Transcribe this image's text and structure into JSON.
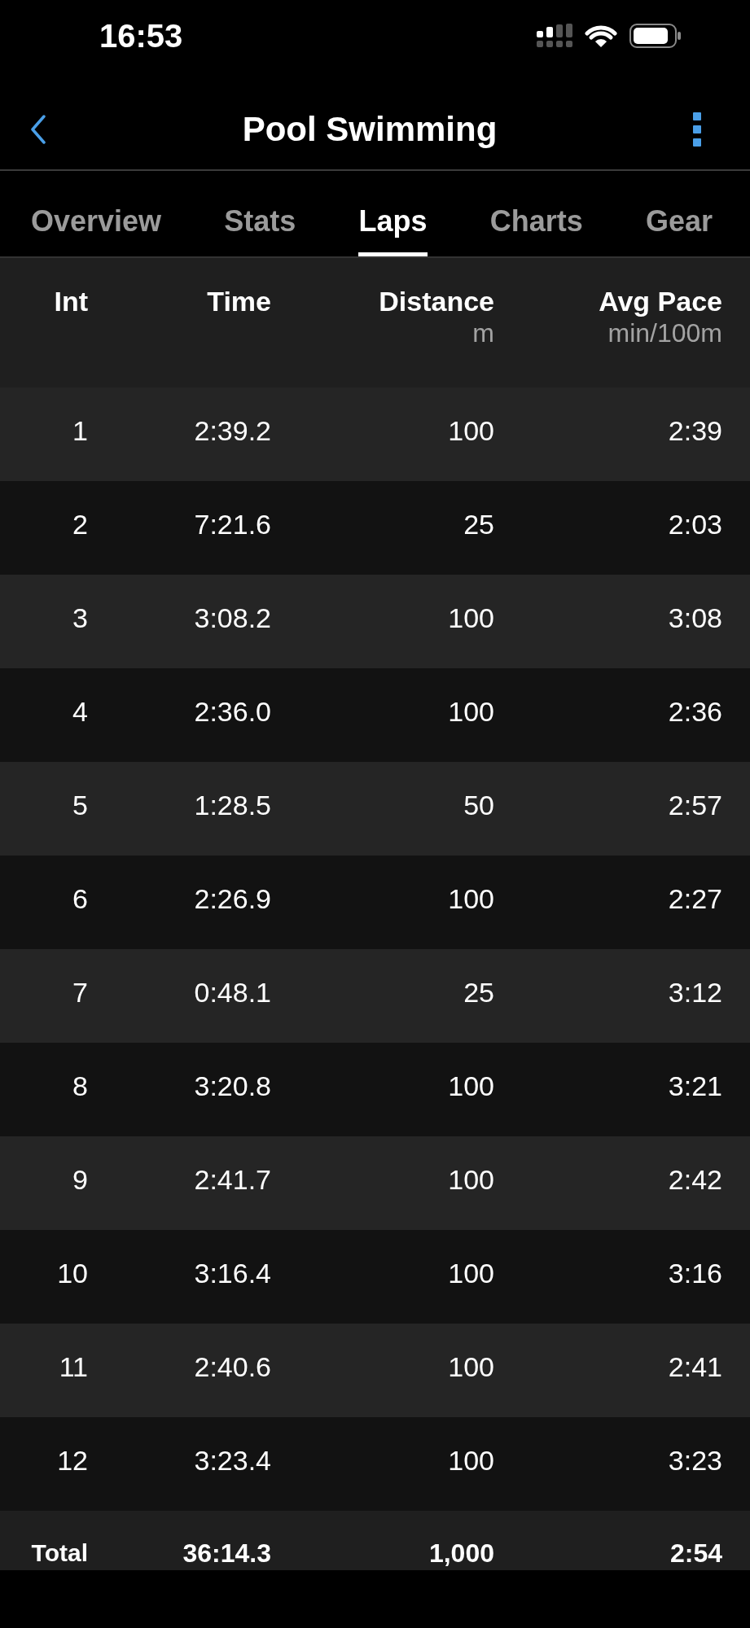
{
  "status_bar": {
    "time": "16:53"
  },
  "nav_bar": {
    "title": "Pool Swimming"
  },
  "tabs": [
    {
      "label": "Overview",
      "selected": false
    },
    {
      "label": "Stats",
      "selected": false
    },
    {
      "label": "Laps",
      "selected": true
    },
    {
      "label": "Charts",
      "selected": false
    },
    {
      "label": "Gear",
      "selected": false
    }
  ],
  "table": {
    "columns": [
      {
        "label": "Int"
      },
      {
        "label": "Time"
      },
      {
        "label": "Distance",
        "unit": "m"
      },
      {
        "label": "Avg Pace",
        "unit": "min/100m"
      }
    ],
    "rows": [
      [
        "1",
        "2:39.2",
        "100",
        "2:39"
      ],
      [
        "2",
        "7:21.6",
        "25",
        "2:03"
      ],
      [
        "3",
        "3:08.2",
        "100",
        "3:08"
      ],
      [
        "4",
        "2:36.0",
        "100",
        "2:36"
      ],
      [
        "5",
        "1:28.5",
        "50",
        "2:57"
      ],
      [
        "6",
        "2:26.9",
        "100",
        "2:27"
      ],
      [
        "7",
        "0:48.1",
        "25",
        "3:12"
      ],
      [
        "8",
        "3:20.8",
        "100",
        "3:21"
      ],
      [
        "9",
        "2:41.7",
        "100",
        "2:42"
      ],
      [
        "10",
        "3:16.4",
        "100",
        "3:16"
      ],
      [
        "11",
        "2:40.6",
        "100",
        "2:41"
      ],
      [
        "12",
        "3:23.4",
        "100",
        "3:23"
      ]
    ],
    "total": [
      "Total",
      "36:14.3",
      "1,000",
      "2:54"
    ]
  }
}
